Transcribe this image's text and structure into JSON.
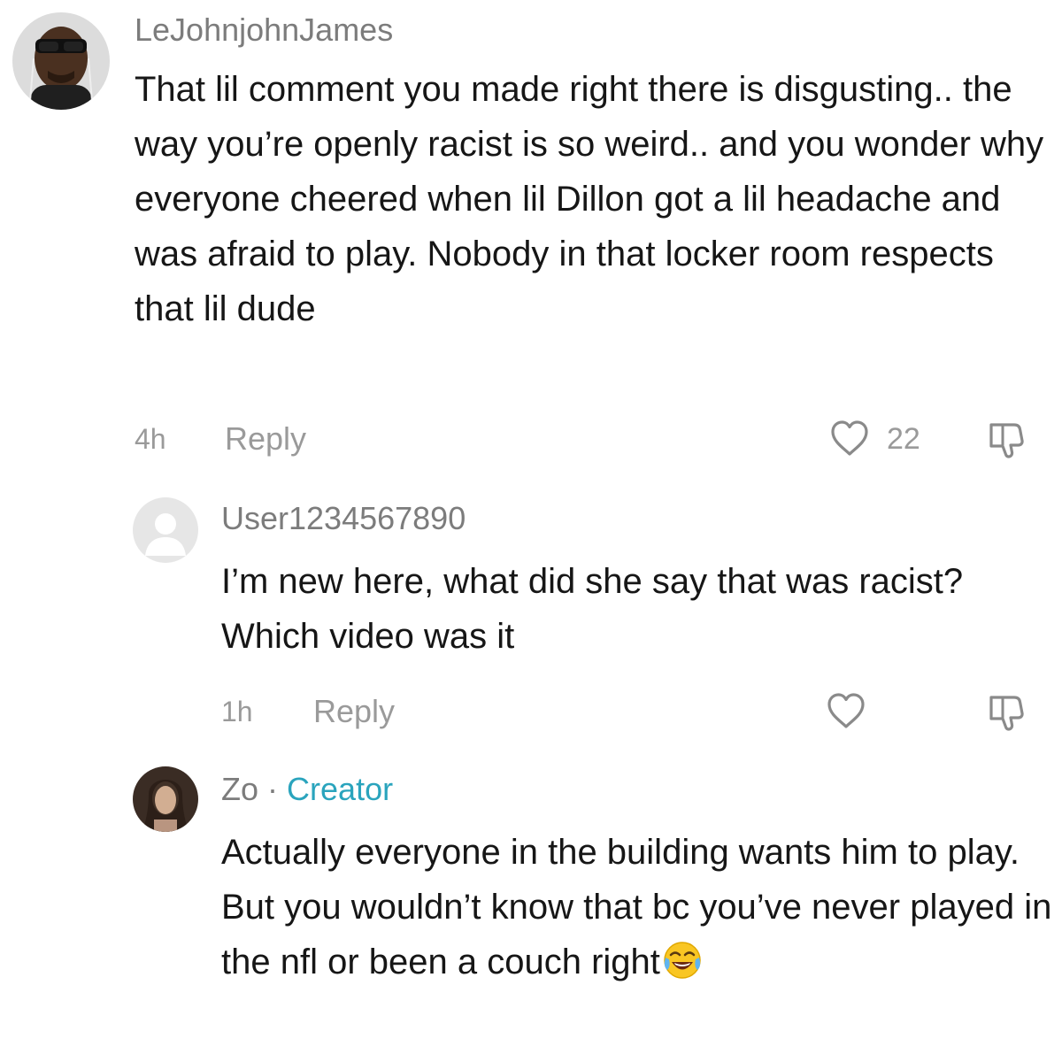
{
  "comments": [
    {
      "username": "LeJohnjohnJames",
      "text": "That lil comment you made right there is disgusting.. the way you’re openly racist is so weird.. and you wonder why everyone cheered when lil Dillon got a lil headache and was afraid to play. Nobody in that locker room respects that lil dude",
      "time": "4h",
      "reply_label": "Reply",
      "likes": "22"
    },
    {
      "username": "User1234567890",
      "text": "I’m new here, what did she say that was racist? Which video was it",
      "time": "1h",
      "reply_label": "Reply"
    },
    {
      "username": "Zo",
      "separator": "·",
      "badge": "Creator",
      "text": "Actually everyone in the building wants him to play. But you wouldn’t know that bc you’ve never played in the nfl or been a couch right"
    }
  ],
  "colors": {
    "muted": "#9a9a9a",
    "creator_badge": "#2aa4bd",
    "text": "#161616"
  },
  "icons": [
    "heart-outline-icon",
    "dislike-icon",
    "face-with-tears-of-joy-emoji"
  ]
}
